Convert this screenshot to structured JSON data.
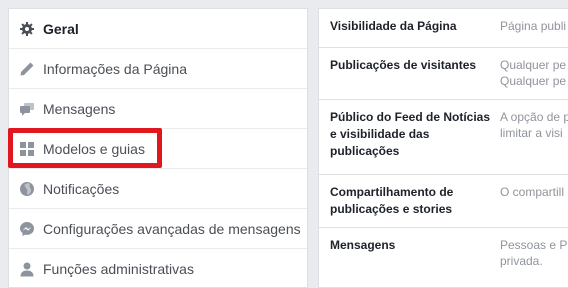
{
  "sidebar": {
    "items": [
      {
        "label": "Geral",
        "icon": "gear-icon"
      },
      {
        "label": "Informações da Página",
        "icon": "pencil-icon"
      },
      {
        "label": "Mensagens",
        "icon": "messages-icon"
      },
      {
        "label": "Modelos e guias",
        "icon": "grid-icon"
      },
      {
        "label": "Notificações",
        "icon": "globe-icon"
      },
      {
        "label": "Configurações avançadas de mensagens",
        "icon": "messenger-icon"
      },
      {
        "label": "Funções administrativas",
        "icon": "person-icon"
      }
    ]
  },
  "settings": {
    "rows": [
      {
        "label": "Visibilidade da Página",
        "value": [
          "Página publi"
        ]
      },
      {
        "label": "Publicações de visitantes",
        "value": [
          "Qualquer pe",
          "Qualquer pe"
        ]
      },
      {
        "label": "Público do Feed de Notícias e visibilidade das publicações",
        "value": [
          "A opção de p",
          "limitar a visi"
        ]
      },
      {
        "label": "Compartilhamento de publicações e stories",
        "value": [
          "O compartill"
        ]
      },
      {
        "label": "Mensagens",
        "value": [
          "Pessoas e P",
          "privada."
        ]
      }
    ]
  },
  "colors": {
    "highlight": "#e0171e",
    "background": "#e9ebee",
    "value_text": "#90949c"
  }
}
